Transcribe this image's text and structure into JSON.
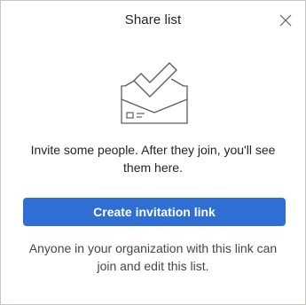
{
  "dialog": {
    "title": "Share list",
    "close_icon": "close-icon",
    "illustration_icon": "envelope-checkmark-icon",
    "message": "Invite some people. After they join, you'll see them here.",
    "primary_button_label": "Create invitation link",
    "footer_note": "Anyone in your organization with this link can join and edit this list."
  },
  "colors": {
    "accent": "#2f6fd3",
    "text": "#252423",
    "secondary_text": "#484644",
    "border": "#c8c6c4",
    "icon_stroke": "#605e5c"
  }
}
